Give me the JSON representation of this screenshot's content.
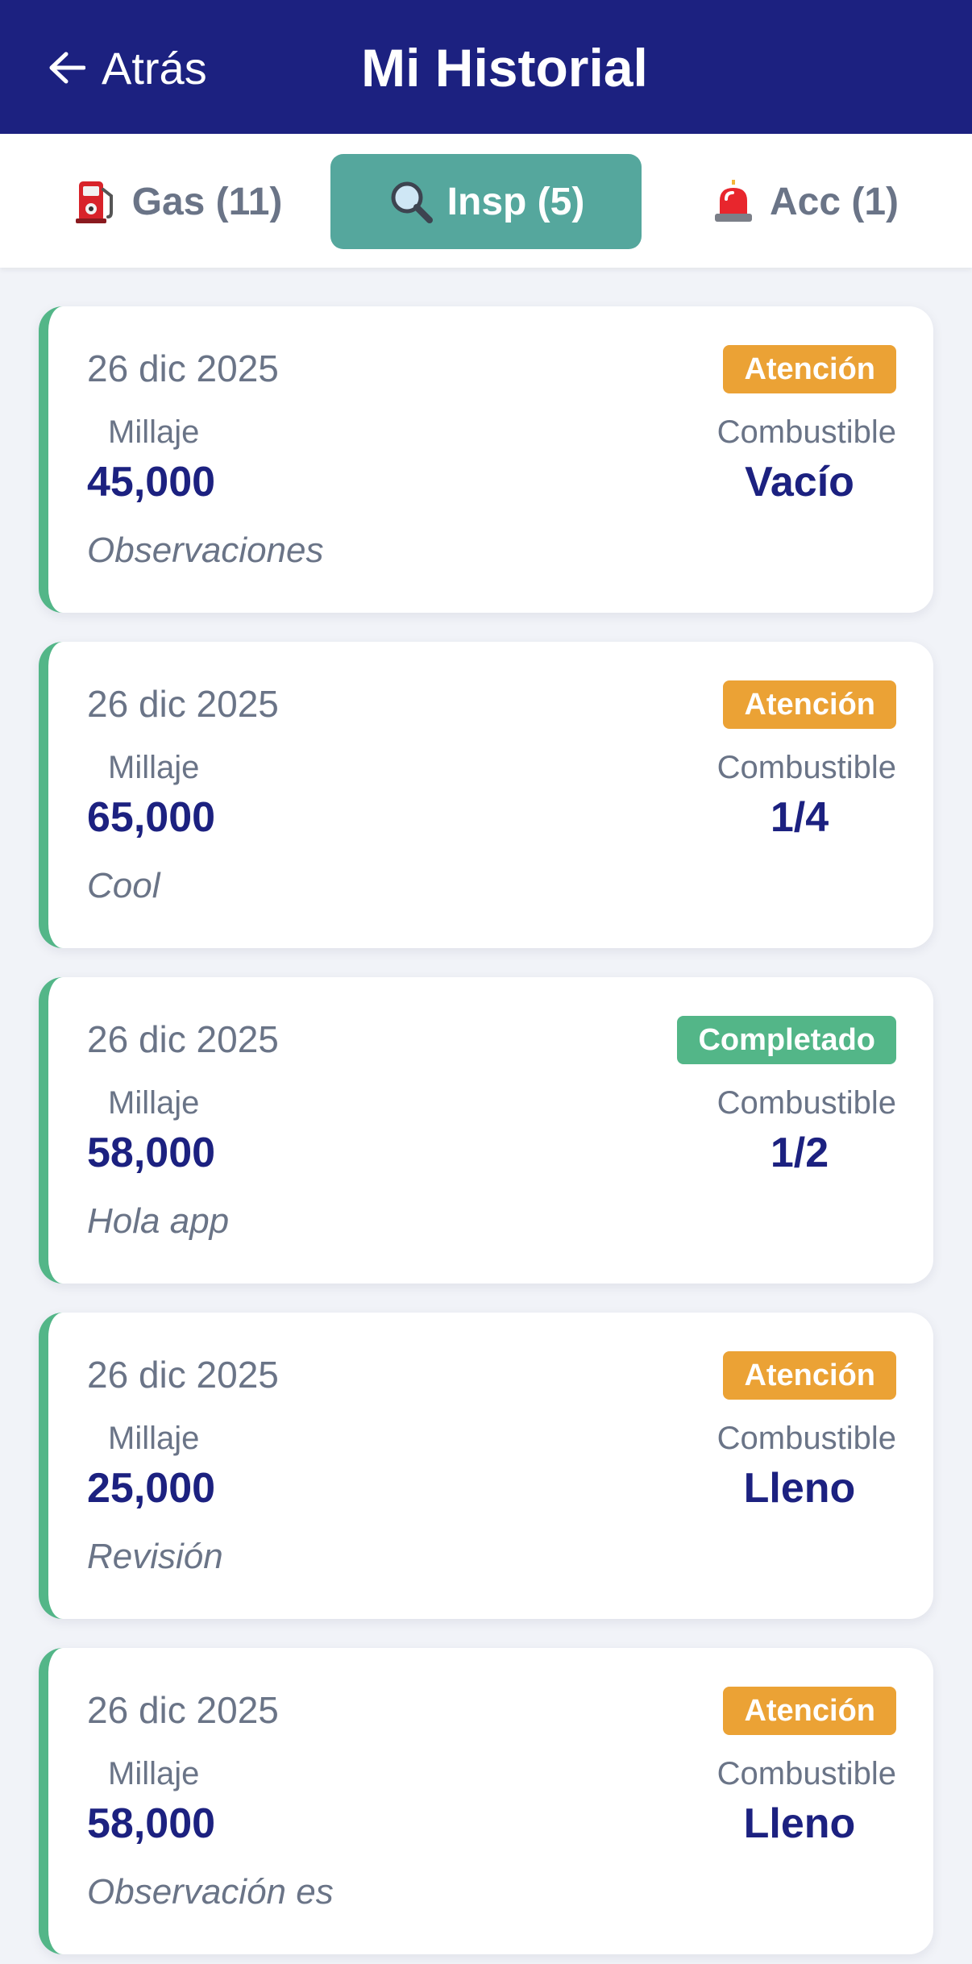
{
  "header": {
    "back_label": "Atrás",
    "title": "Mi Historial"
  },
  "tabs": [
    {
      "label": "Gas (11)",
      "icon": "fuel-pump-icon",
      "active": false
    },
    {
      "label": "Insp (5)",
      "icon": "magnifier-icon",
      "active": true
    },
    {
      "label": "Acc (1)",
      "icon": "siren-icon",
      "active": false
    }
  ],
  "labels": {
    "mileage": "Millaje",
    "fuel": "Combustible"
  },
  "inspections": [
    {
      "date": "26 dic 2025",
      "status": "Atención",
      "mileage": "45,000",
      "fuel": "Vacío",
      "notes": "Observaciones"
    },
    {
      "date": "26 dic 2025",
      "status": "Atención",
      "mileage": "65,000",
      "fuel": "1/4",
      "notes": "Cool"
    },
    {
      "date": "26 dic 2025",
      "status": "Completado",
      "mileage": "58,000",
      "fuel": "1/2",
      "notes": "Hola app"
    },
    {
      "date": "26 dic 2025",
      "status": "Atención",
      "mileage": "25,000",
      "fuel": "Lleno",
      "notes": "Revisión"
    },
    {
      "date": "26 dic 2025",
      "status": "Atención",
      "mileage": "58,000",
      "fuel": "Lleno",
      "notes": "Observación es"
    }
  ],
  "colors": {
    "header_bg": "#1c2180",
    "active_tab": "#55a79d",
    "warning_badge": "#eba235",
    "success_badge": "#53b688",
    "card_accent": "#53b688"
  }
}
